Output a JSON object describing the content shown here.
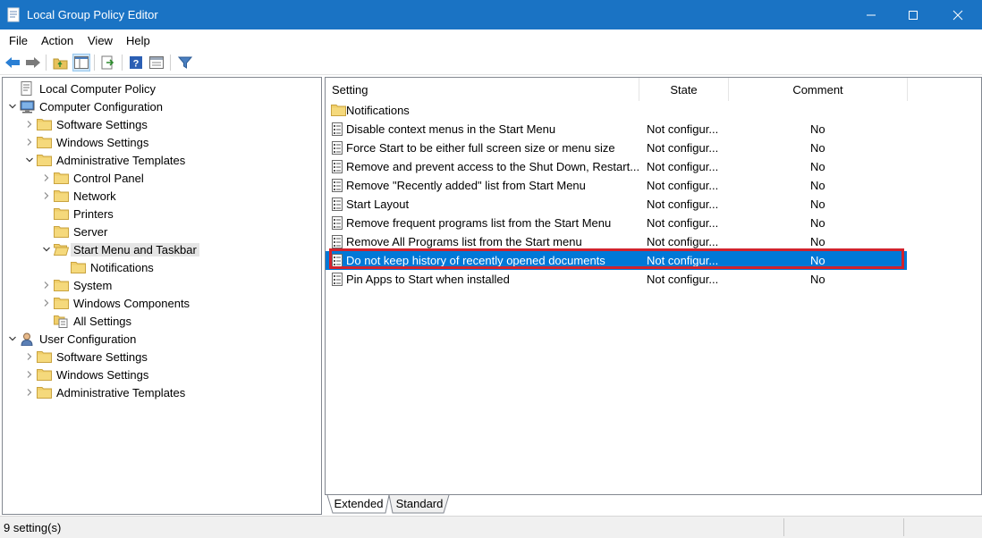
{
  "window": {
    "title": "Local Group Policy Editor"
  },
  "menu": [
    "File",
    "Action",
    "View",
    "Help"
  ],
  "tree": [
    {
      "label": "Local Computer Policy",
      "icon": "policy-icon",
      "chevron": "none"
    },
    {
      "label": "Computer Configuration",
      "icon": "computer-icon",
      "chevron": "down"
    },
    {
      "label": "Software Settings",
      "icon": "folder-icon",
      "chevron": "right"
    },
    {
      "label": "Windows Settings",
      "icon": "folder-icon",
      "chevron": "right"
    },
    {
      "label": "Administrative Templates",
      "icon": "folder-icon",
      "chevron": "down"
    },
    {
      "label": "Control Panel",
      "icon": "folder-icon",
      "chevron": "right"
    },
    {
      "label": "Network",
      "icon": "folder-icon",
      "chevron": "right"
    },
    {
      "label": "Printers",
      "icon": "folder-icon",
      "chevron": "none"
    },
    {
      "label": "Server",
      "icon": "folder-icon",
      "chevron": "none"
    },
    {
      "label": "Start Menu and Taskbar",
      "icon": "folder-open-icon",
      "chevron": "down",
      "selected": true
    },
    {
      "label": "Notifications",
      "icon": "folder-icon",
      "chevron": "none"
    },
    {
      "label": "System",
      "icon": "folder-icon",
      "chevron": "right"
    },
    {
      "label": "Windows Components",
      "icon": "folder-icon",
      "chevron": "right"
    },
    {
      "label": "All Settings",
      "icon": "all-settings-icon",
      "chevron": "none"
    },
    {
      "label": "User Configuration",
      "icon": "user-icon",
      "chevron": "down"
    },
    {
      "label": "Software Settings",
      "icon": "folder-icon",
      "chevron": "right"
    },
    {
      "label": "Windows Settings",
      "icon": "folder-icon",
      "chevron": "right"
    },
    {
      "label": "Administrative Templates",
      "icon": "folder-icon",
      "chevron": "right"
    }
  ],
  "columns": {
    "setting": "Setting",
    "state": "State",
    "comment": "Comment"
  },
  "rows": [
    {
      "setting": "Notifications",
      "state": "",
      "comment": "",
      "icon": "folder-icon"
    },
    {
      "setting": "Disable context menus in the Start Menu",
      "state": "Not configur...",
      "comment": "No",
      "icon": "policy-setting-icon"
    },
    {
      "setting": "Force Start to be either full screen size or menu size",
      "state": "Not configur...",
      "comment": "No",
      "icon": "policy-setting-icon"
    },
    {
      "setting": "Remove and prevent access to the Shut Down, Restart...",
      "state": "Not configur...",
      "comment": "No",
      "icon": "policy-setting-icon"
    },
    {
      "setting": "Remove \"Recently added\" list from Start Menu",
      "state": "Not configur...",
      "comment": "No",
      "icon": "policy-setting-icon"
    },
    {
      "setting": "Start Layout",
      "state": "Not configur...",
      "comment": "No",
      "icon": "policy-setting-icon"
    },
    {
      "setting": "Remove frequent programs list from the Start Menu",
      "state": "Not configur...",
      "comment": "No",
      "icon": "policy-setting-icon"
    },
    {
      "setting": "Remove All Programs list from the Start menu",
      "state": "Not configur...",
      "comment": "No",
      "icon": "policy-setting-icon"
    },
    {
      "setting": "Do not keep history of recently opened documents",
      "state": "Not configur...",
      "comment": "No",
      "icon": "policy-setting-icon",
      "highlighted": true
    },
    {
      "setting": "Pin Apps to Start when installed",
      "state": "Not configur...",
      "comment": "No",
      "icon": "policy-setting-icon"
    }
  ],
  "tabs": [
    "Extended",
    "Standard"
  ],
  "status": {
    "text": "9 setting(s)"
  },
  "colors": {
    "titlebar": "#1a73c4",
    "selection": "#0078d7",
    "highlight_box": "#d2222d",
    "folder": "#e8c25c"
  }
}
